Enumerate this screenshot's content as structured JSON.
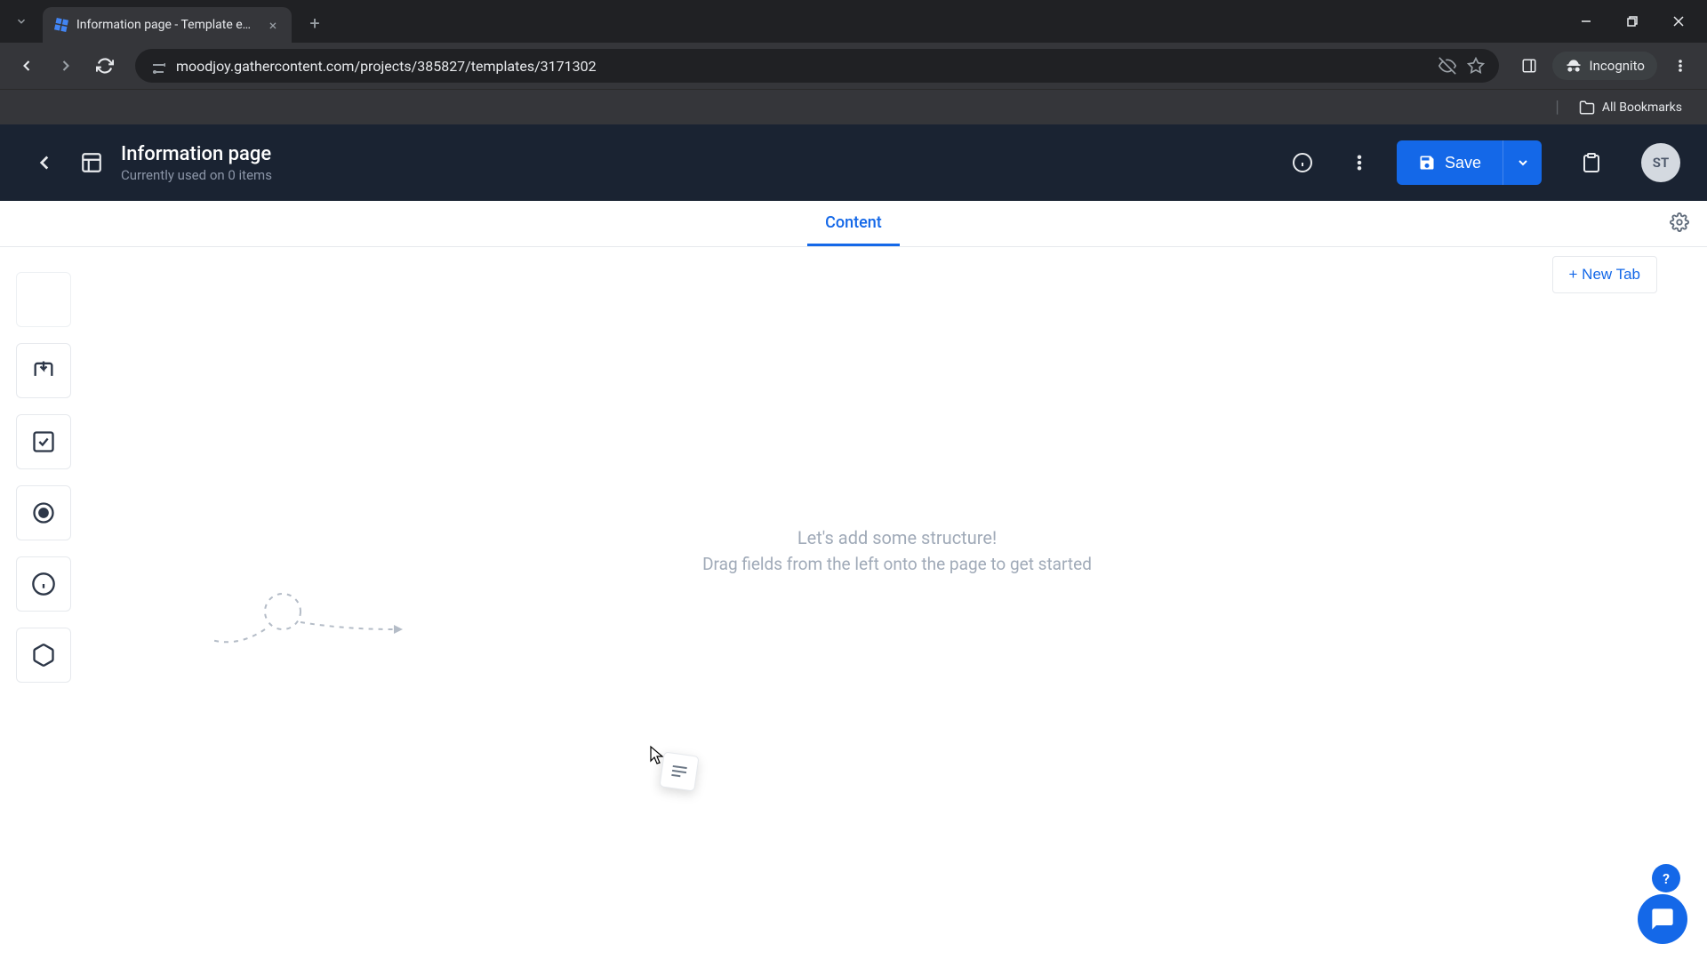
{
  "browser": {
    "tab_title": "Information page - Template e…",
    "url": "moodjoy.gathercontent.com/projects/385827/templates/3171302",
    "incognito_label": "Incognito",
    "bookmarks_label": "All Bookmarks"
  },
  "header": {
    "title": "Information page",
    "subtitle": "Currently used on 0 items",
    "save_label": "Save",
    "avatar_initials": "ST"
  },
  "tabs": {
    "active": "Content",
    "new_tab_label": "+ New Tab"
  },
  "empty_state": {
    "title": "Let's add some structure!",
    "subtitle": "Drag fields from the left onto the page to get started"
  },
  "help_label": "?",
  "palette_items": [
    "text",
    "attachment",
    "checkbox",
    "radio",
    "guidelines",
    "component"
  ]
}
